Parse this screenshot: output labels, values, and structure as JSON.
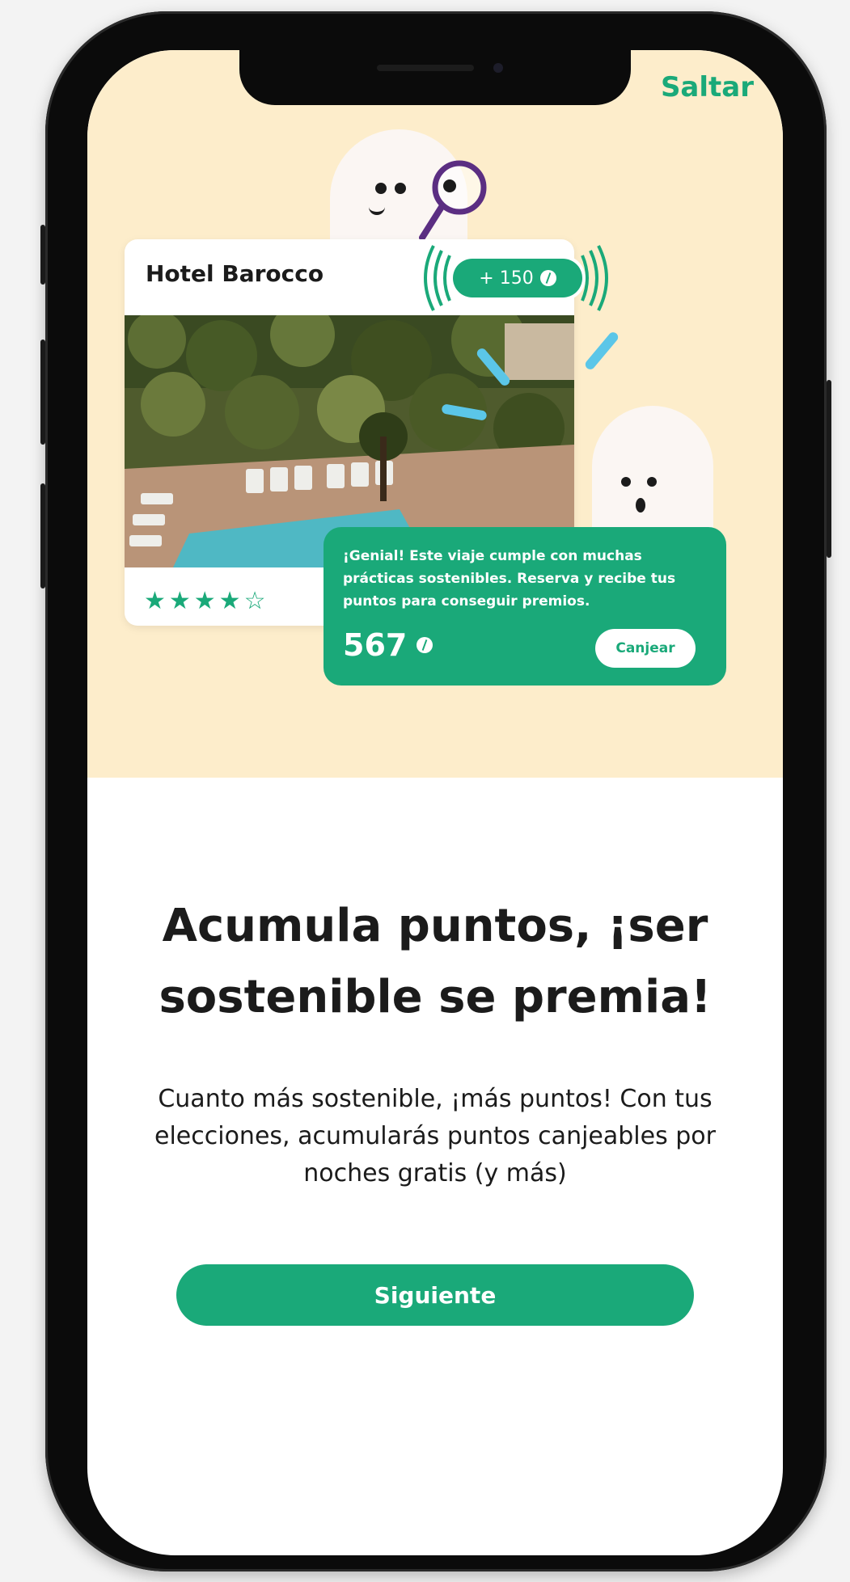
{
  "header": {
    "skip_label": "Saltar"
  },
  "hotel_card": {
    "name": "Hotel Barocco",
    "points_earned": "+ 150",
    "rating_stars": "★★★★☆",
    "rating_value": 4,
    "rating_max": 5
  },
  "info_card": {
    "message": "¡Genial! Este viaje cumple con muchas prácticas sostenibles. Reserva y recibe tus puntos para conseguir premios.",
    "points_total": "567",
    "redeem_label": "Canjear"
  },
  "main": {
    "title": "Acumula puntos, ¡ser sostenible se premia!",
    "description": "Cuanto más sostenible, ¡más puntos! Con tus elecciones, acumularás puntos canjeables por noches gratis (y más)",
    "next_label": "Siguiente"
  },
  "icons": {
    "leaf": "leaf-icon",
    "magnifier": "magnifying-glass-icon",
    "ghost": "ghost-icon"
  },
  "colors": {
    "accent": "#1aa979",
    "hero_background": "#fdedcb",
    "magnifier": "#5b2e82",
    "rays": "#5bc6e8"
  }
}
